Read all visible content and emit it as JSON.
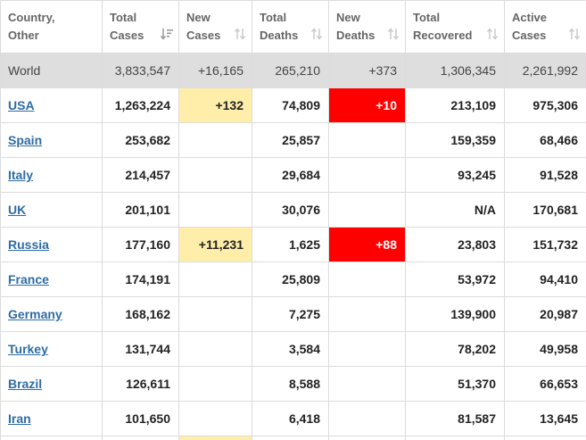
{
  "table": {
    "headers": [
      {
        "label": "Country,\nOther",
        "name": "country-other"
      },
      {
        "label": "Total\nCases",
        "name": "total-cases",
        "active": true
      },
      {
        "label": "New\nCases",
        "name": "new-cases"
      },
      {
        "label": "Total\nDeaths",
        "name": "total-deaths"
      },
      {
        "label": "New\nDeaths",
        "name": "new-deaths"
      },
      {
        "label": "Total\nRecovered",
        "name": "total-recovered"
      },
      {
        "label": "Active\nCases",
        "name": "active-cases"
      }
    ],
    "world": {
      "country": "World",
      "total_cases": "3,833,547",
      "new_cases": "+16,165",
      "total_deaths": "265,210",
      "new_deaths": "+373",
      "total_recovered": "1,306,345",
      "active_cases": "2,261,992"
    },
    "rows": [
      {
        "country": "USA",
        "total_cases": "1,263,224",
        "new_cases": "+132",
        "total_deaths": "74,809",
        "new_deaths": "+10",
        "total_recovered": "213,109",
        "active_cases": "975,306"
      },
      {
        "country": "Spain",
        "total_cases": "253,682",
        "new_cases": "",
        "total_deaths": "25,857",
        "new_deaths": "",
        "total_recovered": "159,359",
        "active_cases": "68,466"
      },
      {
        "country": "Italy",
        "total_cases": "214,457",
        "new_cases": "",
        "total_deaths": "29,684",
        "new_deaths": "",
        "total_recovered": "93,245",
        "active_cases": "91,528"
      },
      {
        "country": "UK",
        "total_cases": "201,101",
        "new_cases": "",
        "total_deaths": "30,076",
        "new_deaths": "",
        "total_recovered": "N/A",
        "active_cases": "170,681"
      },
      {
        "country": "Russia",
        "total_cases": "177,160",
        "new_cases": "+11,231",
        "total_deaths": "1,625",
        "new_deaths": "+88",
        "total_recovered": "23,803",
        "active_cases": "151,732"
      },
      {
        "country": "France",
        "total_cases": "174,191",
        "new_cases": "",
        "total_deaths": "25,809",
        "new_deaths": "",
        "total_recovered": "53,972",
        "active_cases": "94,410"
      },
      {
        "country": "Germany",
        "total_cases": "168,162",
        "new_cases": "",
        "total_deaths": "7,275",
        "new_deaths": "",
        "total_recovered": "139,900",
        "active_cases": "20,987"
      },
      {
        "country": "Turkey",
        "total_cases": "131,744",
        "new_cases": "",
        "total_deaths": "3,584",
        "new_deaths": "",
        "total_recovered": "78,202",
        "active_cases": "49,958"
      },
      {
        "country": "Brazil",
        "total_cases": "126,611",
        "new_cases": "",
        "total_deaths": "8,588",
        "new_deaths": "",
        "total_recovered": "51,370",
        "active_cases": "66,653"
      },
      {
        "country": "Iran",
        "total_cases": "101,650",
        "new_cases": "",
        "total_deaths": "6,418",
        "new_deaths": "",
        "total_recovered": "81,587",
        "active_cases": "13,645"
      }
    ]
  },
  "colors": {
    "link": "#2e6ca5",
    "world_row_bg": "#dedede",
    "new_cases_highlight": "#ffeeaa",
    "new_deaths_highlight": "#ff0000",
    "header_text": "#666666",
    "sort_icon": "#cccccc",
    "sort_icon_active": "#999999"
  },
  "icons": {
    "sort": "sort-arrows-icon",
    "sort_active": "sort-descending-icon"
  }
}
